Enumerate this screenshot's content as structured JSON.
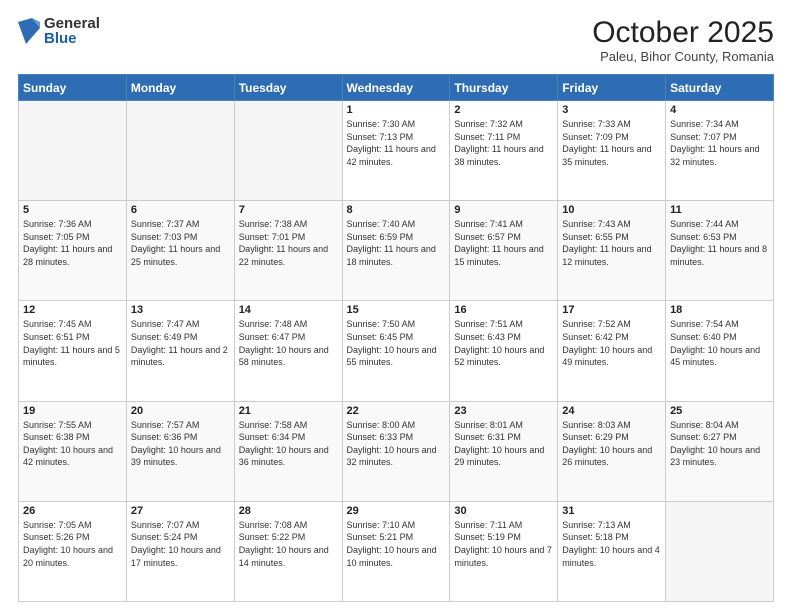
{
  "header": {
    "logo_general": "General",
    "logo_blue": "Blue",
    "title": "October 2025",
    "subtitle": "Paleu, Bihor County, Romania"
  },
  "days_of_week": [
    "Sunday",
    "Monday",
    "Tuesday",
    "Wednesday",
    "Thursday",
    "Friday",
    "Saturday"
  ],
  "weeks": [
    [
      {
        "day": "",
        "sunrise": "",
        "sunset": "",
        "daylight": ""
      },
      {
        "day": "",
        "sunrise": "",
        "sunset": "",
        "daylight": ""
      },
      {
        "day": "",
        "sunrise": "",
        "sunset": "",
        "daylight": ""
      },
      {
        "day": "1",
        "sunrise": "Sunrise: 7:30 AM",
        "sunset": "Sunset: 7:13 PM",
        "daylight": "Daylight: 11 hours and 42 minutes."
      },
      {
        "day": "2",
        "sunrise": "Sunrise: 7:32 AM",
        "sunset": "Sunset: 7:11 PM",
        "daylight": "Daylight: 11 hours and 38 minutes."
      },
      {
        "day": "3",
        "sunrise": "Sunrise: 7:33 AM",
        "sunset": "Sunset: 7:09 PM",
        "daylight": "Daylight: 11 hours and 35 minutes."
      },
      {
        "day": "4",
        "sunrise": "Sunrise: 7:34 AM",
        "sunset": "Sunset: 7:07 PM",
        "daylight": "Daylight: 11 hours and 32 minutes."
      }
    ],
    [
      {
        "day": "5",
        "sunrise": "Sunrise: 7:36 AM",
        "sunset": "Sunset: 7:05 PM",
        "daylight": "Daylight: 11 hours and 28 minutes."
      },
      {
        "day": "6",
        "sunrise": "Sunrise: 7:37 AM",
        "sunset": "Sunset: 7:03 PM",
        "daylight": "Daylight: 11 hours and 25 minutes."
      },
      {
        "day": "7",
        "sunrise": "Sunrise: 7:38 AM",
        "sunset": "Sunset: 7:01 PM",
        "daylight": "Daylight: 11 hours and 22 minutes."
      },
      {
        "day": "8",
        "sunrise": "Sunrise: 7:40 AM",
        "sunset": "Sunset: 6:59 PM",
        "daylight": "Daylight: 11 hours and 18 minutes."
      },
      {
        "day": "9",
        "sunrise": "Sunrise: 7:41 AM",
        "sunset": "Sunset: 6:57 PM",
        "daylight": "Daylight: 11 hours and 15 minutes."
      },
      {
        "day": "10",
        "sunrise": "Sunrise: 7:43 AM",
        "sunset": "Sunset: 6:55 PM",
        "daylight": "Daylight: 11 hours and 12 minutes."
      },
      {
        "day": "11",
        "sunrise": "Sunrise: 7:44 AM",
        "sunset": "Sunset: 6:53 PM",
        "daylight": "Daylight: 11 hours and 8 minutes."
      }
    ],
    [
      {
        "day": "12",
        "sunrise": "Sunrise: 7:45 AM",
        "sunset": "Sunset: 6:51 PM",
        "daylight": "Daylight: 11 hours and 5 minutes."
      },
      {
        "day": "13",
        "sunrise": "Sunrise: 7:47 AM",
        "sunset": "Sunset: 6:49 PM",
        "daylight": "Daylight: 11 hours and 2 minutes."
      },
      {
        "day": "14",
        "sunrise": "Sunrise: 7:48 AM",
        "sunset": "Sunset: 6:47 PM",
        "daylight": "Daylight: 10 hours and 58 minutes."
      },
      {
        "day": "15",
        "sunrise": "Sunrise: 7:50 AM",
        "sunset": "Sunset: 6:45 PM",
        "daylight": "Daylight: 10 hours and 55 minutes."
      },
      {
        "day": "16",
        "sunrise": "Sunrise: 7:51 AM",
        "sunset": "Sunset: 6:43 PM",
        "daylight": "Daylight: 10 hours and 52 minutes."
      },
      {
        "day": "17",
        "sunrise": "Sunrise: 7:52 AM",
        "sunset": "Sunset: 6:42 PM",
        "daylight": "Daylight: 10 hours and 49 minutes."
      },
      {
        "day": "18",
        "sunrise": "Sunrise: 7:54 AM",
        "sunset": "Sunset: 6:40 PM",
        "daylight": "Daylight: 10 hours and 45 minutes."
      }
    ],
    [
      {
        "day": "19",
        "sunrise": "Sunrise: 7:55 AM",
        "sunset": "Sunset: 6:38 PM",
        "daylight": "Daylight: 10 hours and 42 minutes."
      },
      {
        "day": "20",
        "sunrise": "Sunrise: 7:57 AM",
        "sunset": "Sunset: 6:36 PM",
        "daylight": "Daylight: 10 hours and 39 minutes."
      },
      {
        "day": "21",
        "sunrise": "Sunrise: 7:58 AM",
        "sunset": "Sunset: 6:34 PM",
        "daylight": "Daylight: 10 hours and 36 minutes."
      },
      {
        "day": "22",
        "sunrise": "Sunrise: 8:00 AM",
        "sunset": "Sunset: 6:33 PM",
        "daylight": "Daylight: 10 hours and 32 minutes."
      },
      {
        "day": "23",
        "sunrise": "Sunrise: 8:01 AM",
        "sunset": "Sunset: 6:31 PM",
        "daylight": "Daylight: 10 hours and 29 minutes."
      },
      {
        "day": "24",
        "sunrise": "Sunrise: 8:03 AM",
        "sunset": "Sunset: 6:29 PM",
        "daylight": "Daylight: 10 hours and 26 minutes."
      },
      {
        "day": "25",
        "sunrise": "Sunrise: 8:04 AM",
        "sunset": "Sunset: 6:27 PM",
        "daylight": "Daylight: 10 hours and 23 minutes."
      }
    ],
    [
      {
        "day": "26",
        "sunrise": "Sunrise: 7:05 AM",
        "sunset": "Sunset: 5:26 PM",
        "daylight": "Daylight: 10 hours and 20 minutes."
      },
      {
        "day": "27",
        "sunrise": "Sunrise: 7:07 AM",
        "sunset": "Sunset: 5:24 PM",
        "daylight": "Daylight: 10 hours and 17 minutes."
      },
      {
        "day": "28",
        "sunrise": "Sunrise: 7:08 AM",
        "sunset": "Sunset: 5:22 PM",
        "daylight": "Daylight: 10 hours and 14 minutes."
      },
      {
        "day": "29",
        "sunrise": "Sunrise: 7:10 AM",
        "sunset": "Sunset: 5:21 PM",
        "daylight": "Daylight: 10 hours and 10 minutes."
      },
      {
        "day": "30",
        "sunrise": "Sunrise: 7:11 AM",
        "sunset": "Sunset: 5:19 PM",
        "daylight": "Daylight: 10 hours and 7 minutes."
      },
      {
        "day": "31",
        "sunrise": "Sunrise: 7:13 AM",
        "sunset": "Sunset: 5:18 PM",
        "daylight": "Daylight: 10 hours and 4 minutes."
      },
      {
        "day": "",
        "sunrise": "",
        "sunset": "",
        "daylight": ""
      }
    ]
  ]
}
